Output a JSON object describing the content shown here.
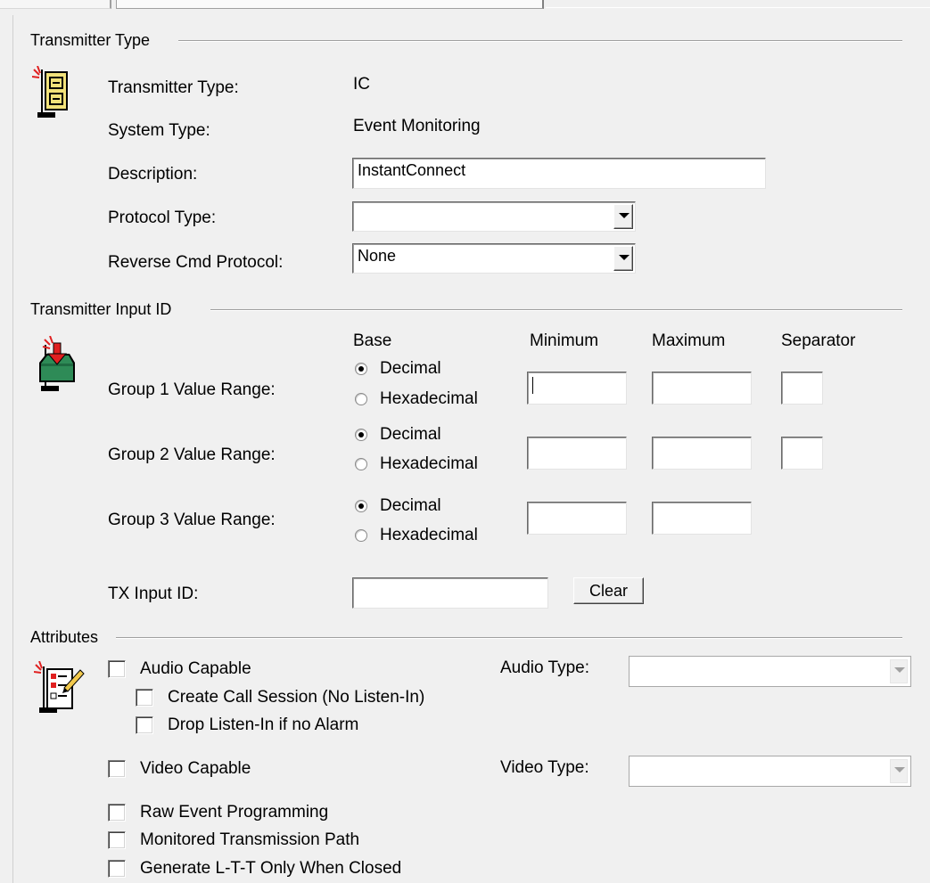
{
  "transmitter_type": {
    "section_title": "Transmitter Type",
    "type_label": "Transmitter Type:",
    "type_value": "IC",
    "system_label": "System Type:",
    "system_value": "Event Monitoring",
    "description_label": "Description:",
    "description_value": "InstantConnect",
    "protocol_label": "Protocol Type:",
    "protocol_value": "",
    "reverse_label": "Reverse Cmd Protocol:",
    "reverse_value": "None",
    "icon": "file-cabinet-icon"
  },
  "input_id": {
    "section_title": "Transmitter Input ID",
    "icon": "inbox-download-icon",
    "headers": {
      "base": "Base",
      "minimum": "Minimum",
      "maximum": "Maximum",
      "separator": "Separator"
    },
    "groups": [
      {
        "label": "Group 1 Value Range:",
        "decimal": "Decimal",
        "hex": "Hexadecimal",
        "selected": "decimal",
        "minimum": "",
        "maximum": "",
        "separator": ""
      },
      {
        "label": "Group 2 Value Range:",
        "decimal": "Decimal",
        "hex": "Hexadecimal",
        "selected": "decimal",
        "minimum": "",
        "maximum": "",
        "separator": ""
      },
      {
        "label": "Group 3 Value Range:",
        "decimal": "Decimal",
        "hex": "Hexadecimal",
        "selected": "decimal",
        "minimum": "",
        "maximum": ""
      }
    ],
    "tx_input_label": "TX Input ID:",
    "tx_input_value": "",
    "clear_label": "Clear"
  },
  "attributes": {
    "section_title": "Attributes",
    "icon": "checklist-icon",
    "audio_capable": "Audio Capable",
    "create_call_session": "Create Call Session (No Listen-In)",
    "drop_listen_in": "Drop Listen-In if no Alarm",
    "video_capable": "Video Capable",
    "raw_event": "Raw Event Programming",
    "monitored_path": "Monitored Transmission Path",
    "generate_ltt": "Generate L-T-T Only When Closed",
    "audio_type_label": "Audio Type:",
    "audio_type_value": "",
    "video_type_label": "Video Type:",
    "video_type_value": ""
  },
  "colors": {
    "background": "#f0f0f0",
    "icon_green": "#2e8b57",
    "icon_yellow": "#f2e27a",
    "icon_red": "#e02020"
  }
}
